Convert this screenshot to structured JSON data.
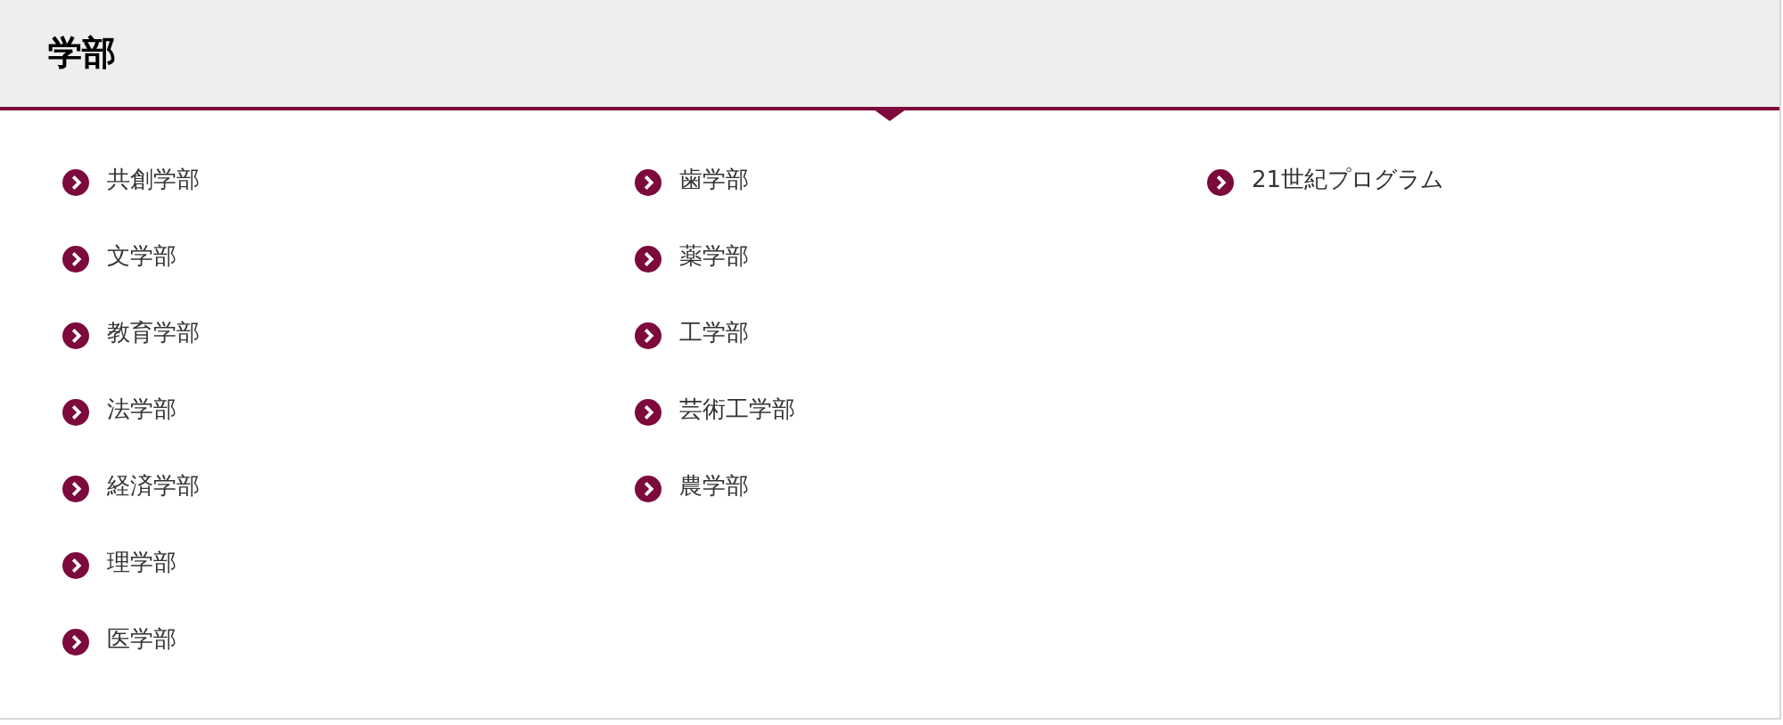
{
  "title": "学部",
  "columns": [
    {
      "links": [
        "共創学部",
        "文学部",
        "教育学部",
        "法学部",
        "経済学部",
        "理学部",
        "医学部"
      ]
    },
    {
      "links": [
        "歯学部",
        "薬学部",
        "工学部",
        "芸術工学部",
        "農学部"
      ]
    },
    {
      "links": [
        "21世紀プログラム"
      ]
    }
  ]
}
